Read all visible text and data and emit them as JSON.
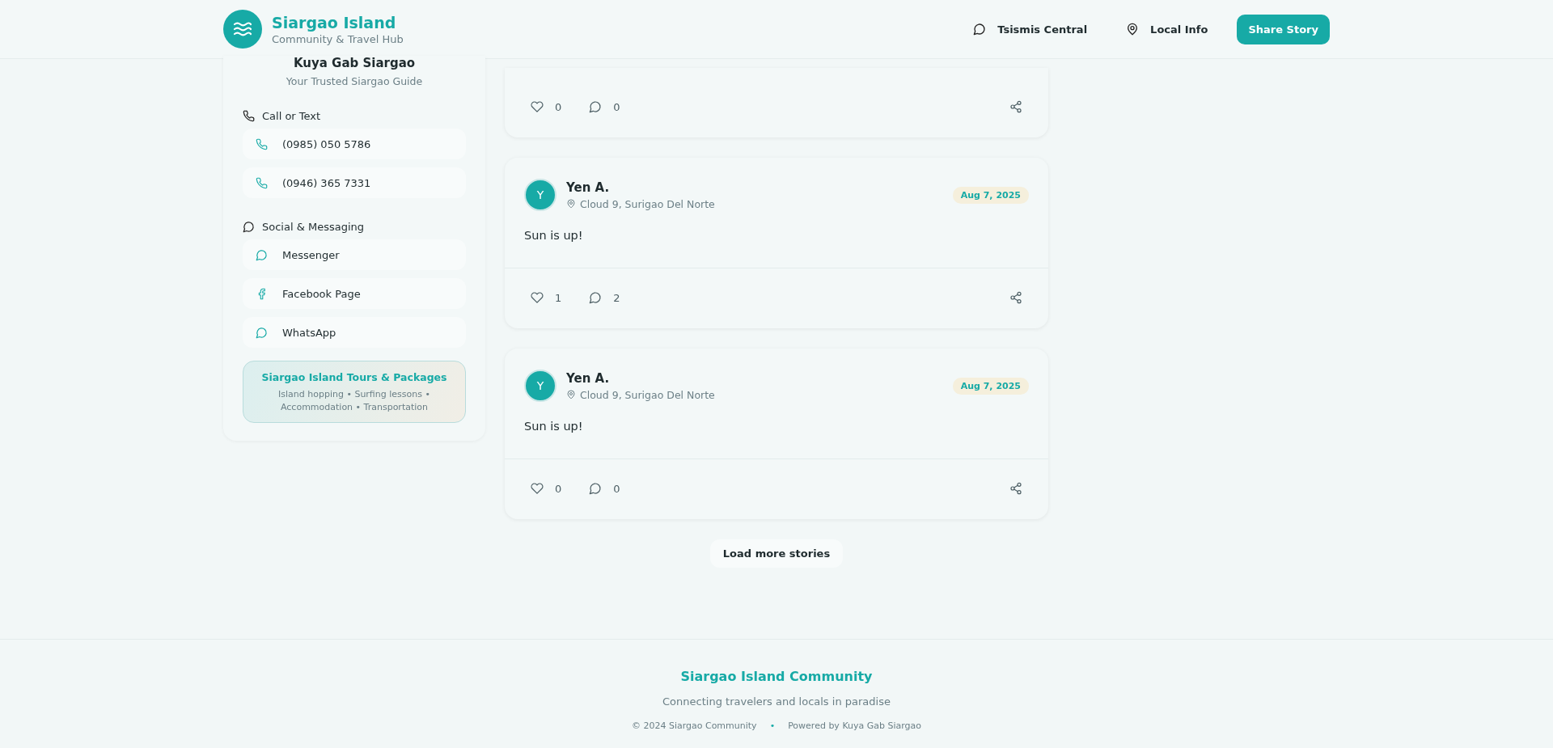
{
  "header": {
    "title": "Siargao Island",
    "subtitle": "Community & Travel Hub",
    "nav": [
      {
        "label": "Tsismis Central",
        "kind": "chat"
      },
      {
        "label": "Local Info",
        "kind": "pin"
      }
    ],
    "cta": "Share Story"
  },
  "guide": {
    "name": "Kuya Gab Siargao",
    "tagline": "Your Trusted Siargao Guide",
    "sections": [
      {
        "title": "Call or Text",
        "kind": "phone",
        "items": [
          {
            "label": "(0985) 050 5786",
            "kind": "phone"
          },
          {
            "label": "(0946) 365 7331",
            "kind": "phone"
          }
        ]
      },
      {
        "title": "Social & Messaging",
        "kind": "chat",
        "items": [
          {
            "label": "Messenger",
            "kind": "chat"
          },
          {
            "label": "Facebook Page",
            "kind": "facebook"
          },
          {
            "label": "WhatsApp",
            "kind": "chat"
          }
        ]
      }
    ],
    "promo": {
      "title": "Siargao Island Tours & Packages",
      "text": "Island hopping • Surfing lessons • Accommodation • Transportation"
    }
  },
  "posts": [
    {
      "partial": true,
      "likes": "0",
      "comments": "0"
    },
    {
      "partial": false,
      "avatar": "Y",
      "author": "Yen A.",
      "location": "Cloud 9, Surigao Del Norte",
      "date": "Aug 7, 2025",
      "body": "Sun is up!",
      "likes": "1",
      "comments": "2"
    },
    {
      "partial": false,
      "avatar": "Y",
      "author": "Yen A.",
      "location": "Cloud 9, Surigao Del Norte",
      "date": "Aug 7, 2025",
      "body": "Sun is up!",
      "likes": "0",
      "comments": "0"
    }
  ],
  "load_more": "Load more stories",
  "footer": {
    "title": "Siargao Island Community",
    "tagline": "Connecting travelers and locals in paradise",
    "copyright": "© 2024 Siargao Community",
    "separator": "•",
    "powered": "Powered by Kuya Gab Siargao"
  }
}
